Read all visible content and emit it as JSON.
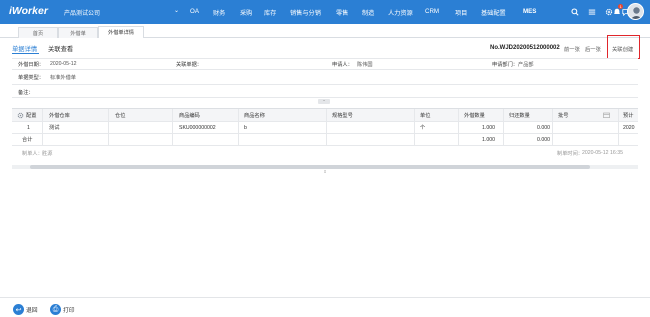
{
  "topbar": {
    "logo": "iWorker",
    "company": "产品测试公司",
    "company_caret": "⌄",
    "nav": [
      "OA",
      "财务",
      "采购",
      "库存",
      "销售与分销",
      "零售",
      "制造",
      "人力资源",
      "CRM",
      "项目",
      "基础配置",
      "MES"
    ],
    "notification_count": "1",
    "colors": {
      "bar": "#2b7fd4",
      "badge": "#e9472f"
    }
  },
  "tabs": [
    "首页",
    "外借单",
    "外借单详情"
  ],
  "subheader": {
    "tabs": [
      "单据详情",
      "关联查看"
    ],
    "doc_no": "No.WJD20200512000002",
    "prev": "前一张",
    "next": "后一张",
    "related_create": "关联创建"
  },
  "form": {
    "borrow_date_label": "外借日期：",
    "borrow_date": "2020-05-12",
    "borrower_label": "关联单据：",
    "borrower": "",
    "applicant_label": "申请人：",
    "applicant": "陈伟国",
    "dept_label": "申请部门：",
    "dept": "产品部",
    "type_label": "单据类型：",
    "type": "标准外借单",
    "remark_label": "备注：",
    "remark": ""
  },
  "table": {
    "headers": [
      "配置",
      "外借仓库",
      "仓位",
      "商品编码",
      "商品名称",
      "规格型号",
      "单位",
      "外借数量",
      "归还数量",
      "批号",
      "",
      "预计"
    ],
    "rows": [
      [
        "1",
        "测试",
        "",
        "SKU000000002",
        "b",
        "",
        "个",
        "1.000",
        "0.000",
        "",
        "",
        "2020"
      ]
    ],
    "summary_label": "合计",
    "summary": [
      "1.000",
      "0.000"
    ],
    "footer_left_label": "制单人：",
    "footer_left": "胜源",
    "footer_right_label": "制单时间：",
    "footer_right": "2020-05-12 16:35"
  },
  "bottom": {
    "back": "退回",
    "print": "打印"
  }
}
